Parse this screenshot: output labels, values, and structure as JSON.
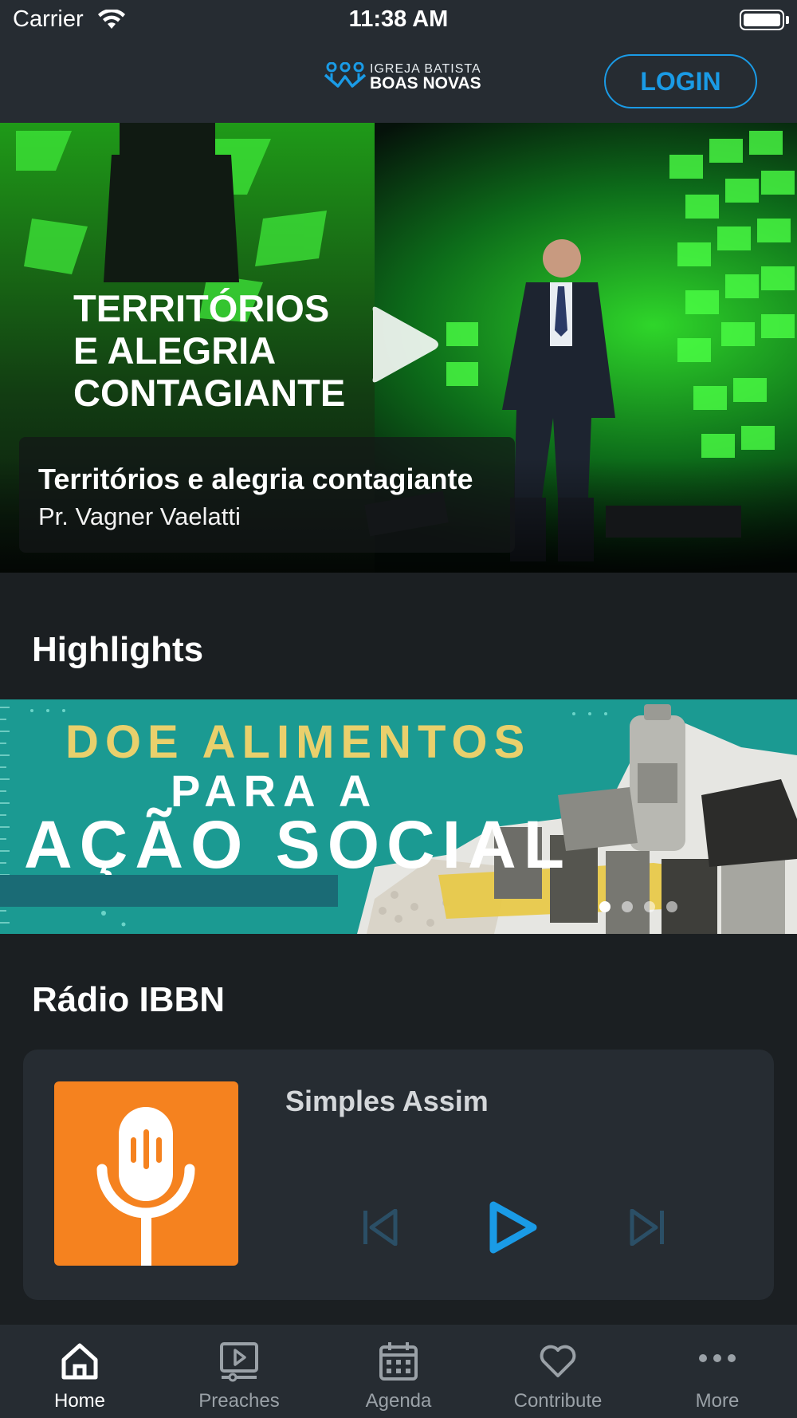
{
  "status_bar": {
    "carrier": "Carrier",
    "time": "11:38 AM"
  },
  "header": {
    "logo_line1": "IGREJA BATISTA",
    "logo_line2": "BOAS NOVAS",
    "login_label": "LOGIN"
  },
  "hero": {
    "overlay_line1": "TERRITÓRIOS",
    "overlay_line2": "E ALEGRIA",
    "overlay_line3": "CONTAGIANTE",
    "title": "Territórios e alegria contagiante",
    "preacher": "Pr. Vagner Vaelatti"
  },
  "highlights": {
    "heading": "Highlights",
    "banner_line1": "DOE ALIMENTOS",
    "banner_line2": "PARA A",
    "banner_line3": "AÇÃO SOCIAL",
    "carousel_pages": 4,
    "active_page": 1
  },
  "radio": {
    "heading": "Rádio IBBN",
    "track": "Simples Assim",
    "art_icon": "microphone-icon"
  },
  "tabbar": {
    "tabs": [
      {
        "label": "Home",
        "icon": "home-icon",
        "active": true
      },
      {
        "label": "Preaches",
        "icon": "video-icon",
        "active": false
      },
      {
        "label": "Agenda",
        "icon": "calendar-icon",
        "active": false
      },
      {
        "label": "Contribute",
        "icon": "heart-icon",
        "active": false
      },
      {
        "label": "More",
        "icon": "more-icon",
        "active": false
      }
    ]
  },
  "colors": {
    "accent": "#1a9be6",
    "background": "#1b1f22",
    "surface": "#262c32",
    "radio_art": "#f5821f",
    "banner_teal": "#1b9a92",
    "banner_yellow": "#e9d06c"
  }
}
